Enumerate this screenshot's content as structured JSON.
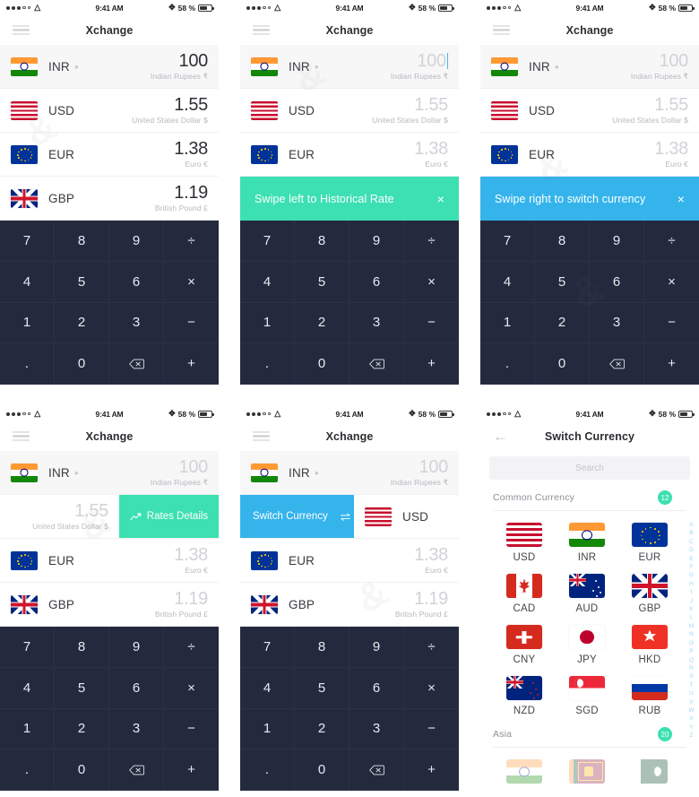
{
  "status_bar": {
    "time": "9:41 AM",
    "battery_percent": "58 %",
    "signal_dots_filled": 3,
    "signal_dots_empty": 2,
    "wifi_icon": "wifi-icon",
    "bluetooth_icon": "bluetooth-icon",
    "battery_icon": "battery-icon"
  },
  "app": {
    "title": "Xchange",
    "menu_icon": "hamburger-menu-icon",
    "back_icon": "back-arrow-icon"
  },
  "currencies": [
    {
      "code": "INR",
      "amount": "100",
      "name": "Indian Rupees ₹",
      "flag": "flag-in",
      "pin": true
    },
    {
      "code": "USD",
      "amount": "1.55",
      "name": "United States Dollar $",
      "flag": "flag-us",
      "pin": false
    },
    {
      "code": "EUR",
      "amount": "1.38",
      "name": "Euro €",
      "flag": "flag-eu",
      "pin": false
    },
    {
      "code": "GBP",
      "amount": "1.19",
      "name": "British Pound £",
      "flag": "flag-gb",
      "pin": false
    }
  ],
  "keypad": {
    "keys": [
      "7",
      "8",
      "9",
      "÷",
      "4",
      "5",
      "6",
      "×",
      "1",
      "2",
      "3",
      "−",
      ".",
      "0",
      "backspace",
      "+"
    ],
    "backspace_icon": "backspace-icon"
  },
  "banners": {
    "historical": {
      "text": "Swipe left to Historical Rate",
      "close": "×",
      "color": "#3ce0b2",
      "close_icon": "close-icon"
    },
    "switch": {
      "text": "Swipe right to switch currency",
      "close": "×",
      "color": "#35b4ec",
      "close_icon": "close-icon"
    }
  },
  "swipe_actions": {
    "rates_details": {
      "label": "Rates Details",
      "icon": "trend-up-icon",
      "color": "#3ce0b2"
    },
    "switch_currency": {
      "label": "Switch Currency",
      "icon": "swap-arrows-icon",
      "color": "#35b4ec"
    }
  },
  "switch_screen": {
    "title": "Switch Currency",
    "search_placeholder": "Search",
    "search_icon": "search-icon",
    "sections": [
      {
        "title": "Common Currency",
        "badge": "12",
        "items": [
          {
            "code": "USD",
            "flag": "flag-us"
          },
          {
            "code": "INR",
            "flag": "flag-in"
          },
          {
            "code": "EUR",
            "flag": "flag-eu"
          },
          {
            "code": "CAD",
            "flag": "flag-ca"
          },
          {
            "code": "AUD",
            "flag": "flag-au"
          },
          {
            "code": "GBP",
            "flag": "flag-gb"
          },
          {
            "code": "CNY",
            "flag": "flag-ch"
          },
          {
            "code": "JPY",
            "flag": "flag-jp"
          },
          {
            "code": "HKD",
            "flag": "flag-hk"
          },
          {
            "code": "NZD",
            "flag": "flag-nz"
          },
          {
            "code": "SGD",
            "flag": "flag-sg"
          },
          {
            "code": "RUB",
            "flag": "flag-ru"
          }
        ]
      },
      {
        "title": "Asia",
        "badge": "20",
        "items": [
          {
            "code": "",
            "flag": "flag-in"
          },
          {
            "code": "",
            "flag": "flag-lk"
          },
          {
            "code": "",
            "flag": "flag-pk"
          }
        ]
      }
    ],
    "alphabet": [
      "A",
      "B",
      "C",
      "D",
      "E",
      "F",
      "G",
      "H",
      "I",
      "J",
      "K",
      "L",
      "M",
      "N",
      "O",
      "P",
      "Q",
      "R",
      "S",
      "T",
      "U",
      "V",
      "W",
      "X",
      "Y",
      "Z"
    ]
  },
  "colors": {
    "teal": "#3ce0b2",
    "blue": "#35b4ec",
    "keypad_bg": "#232a3d",
    "text_dark": "#2f2f35",
    "text_muted": "#b8b8bf"
  }
}
